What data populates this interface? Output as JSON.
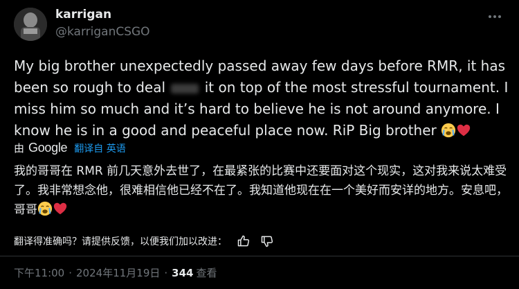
{
  "user": {
    "display_name": "karrigan",
    "handle": "@karriganCSGO"
  },
  "tweet": {
    "text_part1": "My big brother unexpectedly passed away few days before RMR, it has been so rough to deal",
    "text_part2": "it on top of the most stressful tournament. I miss him so much and it’s hard to believe he is not around anymore. I know he is in a good and peaceful place now. RiP Big brother",
    "emojis": [
      "loudly-crying-face",
      "red-heart"
    ]
  },
  "translation": {
    "by_label": "由",
    "provider": "Google",
    "link_text": "翻译自 英语",
    "text": "我的哥哥在 RMR 前几天意外去世了，在最紧张的比赛中还要面对这个现实，这对我来说太难受了。我非常想念他，很难相信他已经不在了。我知道他现在在一个美好而安详的地方。安息吧，哥哥",
    "feedback_prompt": "翻译得准确吗？请提供反馈，以便我们加以改进："
  },
  "meta": {
    "time": "下午11:00",
    "separator": "·",
    "date": "2024年11月19日",
    "views_count": "344",
    "views_label": "查看"
  },
  "colors": {
    "background": "#000000",
    "text_primary": "#e7e9ea",
    "text_secondary": "#71767b",
    "link": "#1d9bf0",
    "heart": "#f91880"
  }
}
